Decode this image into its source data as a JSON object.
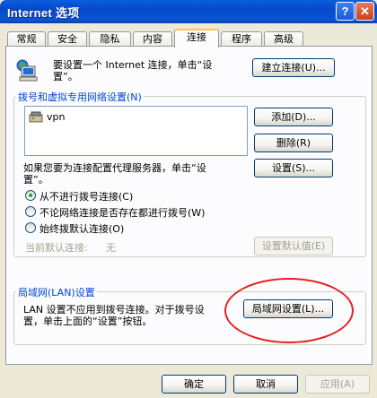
{
  "window": {
    "title": "Internet 选项",
    "help_label": "?",
    "close_label": "✕"
  },
  "tabs": [
    {
      "label": "常规"
    },
    {
      "label": "安全"
    },
    {
      "label": "隐私"
    },
    {
      "label": "内容"
    },
    {
      "label": "连接",
      "active": true
    },
    {
      "label": "程序"
    },
    {
      "label": "高级"
    }
  ],
  "setup": {
    "text_line1": "要设置一个 Internet 连接，单击“设",
    "text_line2": "置”。",
    "button": "建立连接(U)..."
  },
  "dialup": {
    "group_label": "拨号和虚拟专用网络设置(N)",
    "connections": [
      "vpn"
    ],
    "add_button": "添加(D)...",
    "delete_button": "删除(R)",
    "proxy_text_line1": "如果您要为连接配置代理服务器，单击“设",
    "proxy_text_line2": "置”。",
    "settings_button": "设置(S)...",
    "options": [
      {
        "label": "从不进行拨号连接(C)",
        "selected": true
      },
      {
        "label": "不论网络连接是否存在都进行拨号(W)",
        "selected": false
      },
      {
        "label": "始终拨默认连接(O)",
        "selected": false
      }
    ],
    "current_default_label": "当前默认连接:",
    "current_default_value": "无",
    "set_default_button": "设置默认值(E)"
  },
  "lan": {
    "group_label": "局域网(LAN)设置",
    "text_line1": "LAN 设置不应用到拨号连接。对于拨号设",
    "text_line2": "置，单击上面的“设置”按钮。",
    "button": "局域网设置(L)..."
  },
  "footer": {
    "ok": "确定",
    "cancel": "取消",
    "apply": "应用(A)"
  },
  "colors": {
    "titlebar": "#0a55d8",
    "annotation": "#e32020",
    "group_label": "#0046d5"
  }
}
